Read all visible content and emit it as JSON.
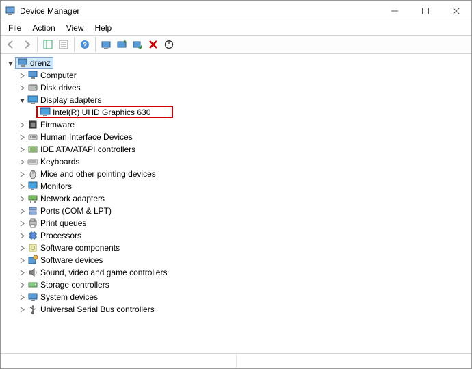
{
  "window": {
    "title": "Device Manager"
  },
  "menu": {
    "file": "File",
    "action": "Action",
    "view": "View",
    "help": "Help"
  },
  "tree": {
    "root": "drenz",
    "items": [
      {
        "id": "computer",
        "label": "Computer",
        "icon": "computer"
      },
      {
        "id": "disk-drives",
        "label": "Disk drives",
        "icon": "disk"
      },
      {
        "id": "display-adapters",
        "label": "Display adapters",
        "icon": "display",
        "expanded": true,
        "children": [
          {
            "id": "intel-uhd-630",
            "label": "Intel(R) UHD Graphics 630",
            "icon": "display",
            "highlighted": true
          }
        ]
      },
      {
        "id": "firmware",
        "label": "Firmware",
        "icon": "firmware"
      },
      {
        "id": "hid",
        "label": "Human Interface Devices",
        "icon": "hid"
      },
      {
        "id": "ide",
        "label": "IDE ATA/ATAPI controllers",
        "icon": "ide"
      },
      {
        "id": "keyboards",
        "label": "Keyboards",
        "icon": "keyboard"
      },
      {
        "id": "mice",
        "label": "Mice and other pointing devices",
        "icon": "mouse"
      },
      {
        "id": "monitors",
        "label": "Monitors",
        "icon": "monitor"
      },
      {
        "id": "network",
        "label": "Network adapters",
        "icon": "network"
      },
      {
        "id": "ports",
        "label": "Ports (COM & LPT)",
        "icon": "ports"
      },
      {
        "id": "print-queues",
        "label": "Print queues",
        "icon": "printer"
      },
      {
        "id": "processors",
        "label": "Processors",
        "icon": "cpu"
      },
      {
        "id": "sw-components",
        "label": "Software components",
        "icon": "swcomp"
      },
      {
        "id": "sw-devices",
        "label": "Software devices",
        "icon": "swdev"
      },
      {
        "id": "sound",
        "label": "Sound, video and game controllers",
        "icon": "sound"
      },
      {
        "id": "storage",
        "label": "Storage controllers",
        "icon": "storage"
      },
      {
        "id": "system",
        "label": "System devices",
        "icon": "system"
      },
      {
        "id": "usb",
        "label": "Universal Serial Bus controllers",
        "icon": "usb"
      }
    ]
  }
}
